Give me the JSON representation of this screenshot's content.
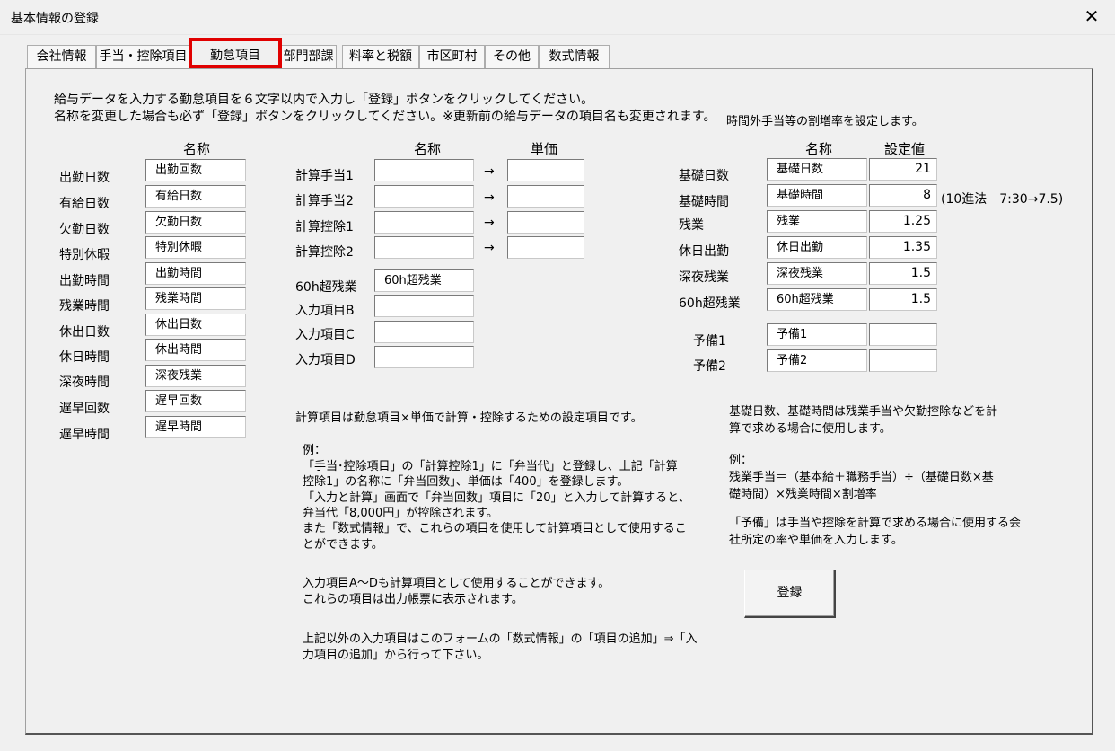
{
  "window": {
    "title": "基本情報の登録",
    "close_glyph": "✕"
  },
  "tabs": [
    "会社情報",
    "手当・控除項目",
    "勤怠項目",
    "部門部課",
    "料率と税額",
    "市区町村",
    "その他",
    "数式情報"
  ],
  "intro": {
    "line1": "給与データを入力する勤怠項目を６文字以内で入力し「登録」ボタンをクリックしてください。",
    "line2": "名称を変更した場合も必ず「登録」ボタンをクリックしてください。※更新前の給与データの項目名も変更されます。"
  },
  "left": {
    "header": "名称",
    "rows": [
      {
        "label": "出勤日数",
        "value": "出勤回数"
      },
      {
        "label": "有給日数",
        "value": "有給日数"
      },
      {
        "label": "欠勤日数",
        "value": "欠勤日数"
      },
      {
        "label": "特別休暇",
        "value": "特別休暇"
      },
      {
        "label": "出勤時間",
        "value": "出勤時間"
      },
      {
        "label": "残業時間",
        "value": "残業時間"
      },
      {
        "label": "休出日数",
        "value": "休出日数"
      },
      {
        "label": "休日時間",
        "value": "休出時間"
      },
      {
        "label": "深夜時間",
        "value": "深夜残業"
      },
      {
        "label": "遅早回数",
        "value": "遅早回数"
      },
      {
        "label": "遅早時間",
        "value": "遅早時間"
      }
    ]
  },
  "middle": {
    "header_name": "名称",
    "header_price": "単価",
    "arrow": "→",
    "calc_rows": [
      {
        "label": "計算手当1",
        "name": "",
        "price": ""
      },
      {
        "label": "計算手当2",
        "name": "",
        "price": ""
      },
      {
        "label": "計算控除1",
        "name": "",
        "price": ""
      },
      {
        "label": "計算控除2",
        "name": "",
        "price": ""
      }
    ],
    "input_rows": [
      {
        "label": "60h超残業",
        "value": "60h超残業"
      },
      {
        "label": "入力項目B",
        "value": ""
      },
      {
        "label": "入力項目C",
        "value": ""
      },
      {
        "label": "入力項目D",
        "value": ""
      }
    ],
    "note_title": "計算項目は勤怠項目×単価で計算・控除するための設定項目です。",
    "example_lines": [
      "例：",
      "「手当･控除項目」の「計算控除1」に「弁当代」と登録し、上記「計算",
      "控除1」の名称に「弁当回数」、単価は「400」を登録します。",
      "「入力と計算」画面で「弁当回数」項目に「20」と入力して計算すると、",
      "弁当代「8,000円」が控除されます。",
      "また「数式情報」で、これらの項目を使用して計算項目として使用するこ",
      "とができます。"
    ],
    "note2_lines": [
      "入力項目A～Dも計算項目として使用することができます。",
      "これらの項目は出力帳票に表示されます。"
    ],
    "note3_lines": [
      "上記以外の入力項目はこのフォームの「数式情報」の「項目の追加」⇒「入",
      "力項目の追加」から行って下さい。"
    ]
  },
  "right": {
    "caption": "時間外手当等の割増率を設定します。",
    "header_name": "名称",
    "header_value": "設定値",
    "rows": [
      {
        "label": "基礎日数",
        "name": "基礎日数",
        "value": "21"
      },
      {
        "label": "基礎時間",
        "name": "基礎時間",
        "value": "8"
      },
      {
        "label": "残業",
        "name": "残業",
        "value": "1.25"
      },
      {
        "label": "休日出勤",
        "name": "休日出勤",
        "value": "1.35"
      },
      {
        "label": "深夜残業",
        "name": "深夜残業",
        "value": "1.5"
      },
      {
        "label": "60h超残業",
        "name": "60h超残業",
        "value": "1.5"
      }
    ],
    "reserve_rows": [
      {
        "label": "予備1",
        "name": "予備1",
        "value": ""
      },
      {
        "label": "予備2",
        "name": "予備2",
        "value": ""
      }
    ],
    "decimal_note": "(10進法　7:30→7.5)",
    "note1_lines": [
      "基礎日数、基礎時間は残業手当や欠勤控除などを計",
      "算で求める場合に使用します。"
    ],
    "note2_lines": [
      "例：",
      "残業手当＝（基本給＋職務手当）÷（基礎日数×基",
      "礎時間）×残業時間×割増率"
    ],
    "note3_lines": [
      "「予備」は手当や控除を計算で求める場合に使用する会",
      "社所定の率や単価を入力します。"
    ],
    "register_button": "登録"
  }
}
